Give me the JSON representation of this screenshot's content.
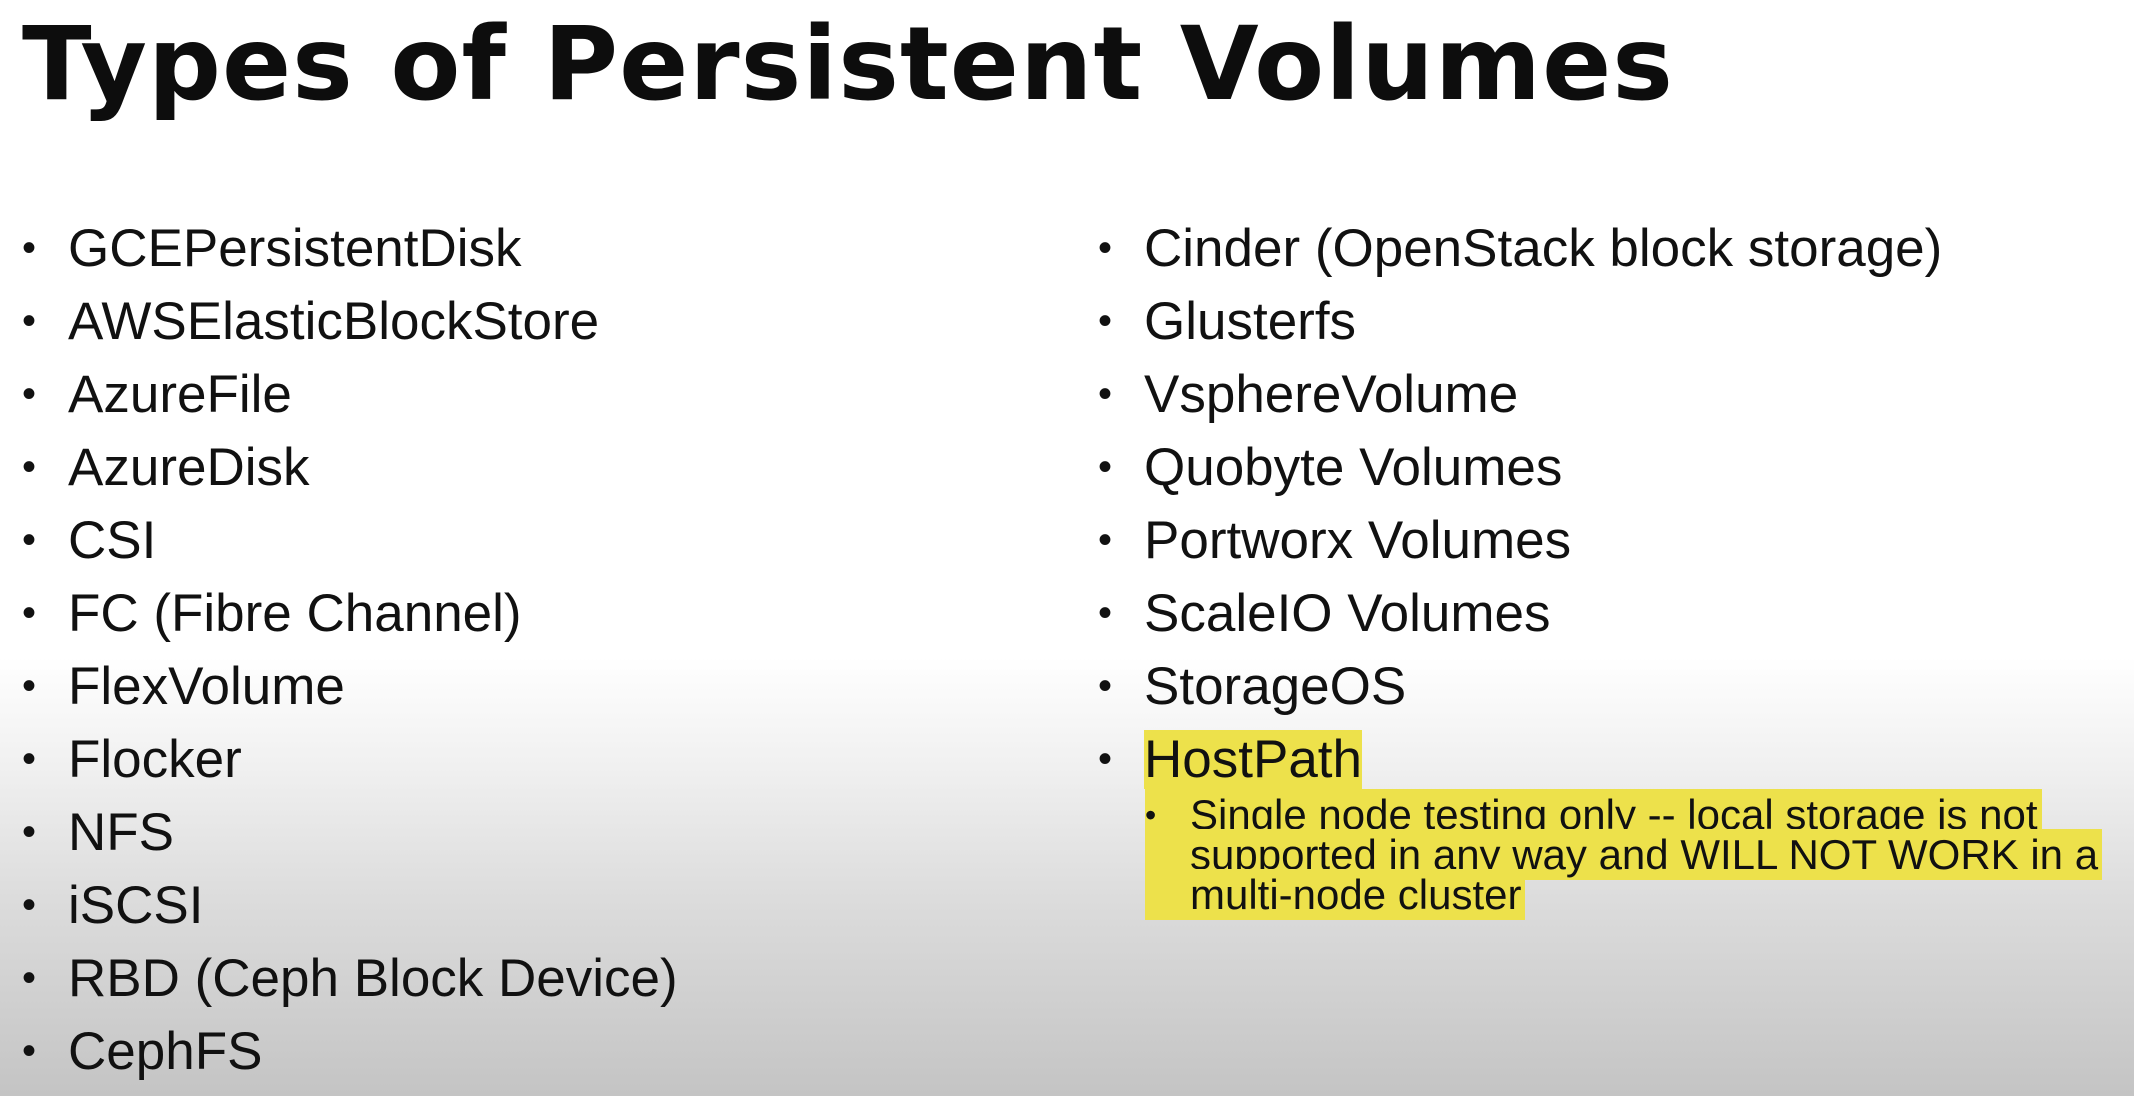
{
  "slide": {
    "title": "Types of Persistent Volumes"
  },
  "left_column": {
    "items": [
      "GCEPersistentDisk",
      "AWSElasticBlockStore",
      "AzureFile",
      "AzureDisk",
      "CSI",
      "FC (Fibre Channel)",
      "FlexVolume",
      "Flocker",
      "NFS",
      "iSCSI",
      "RBD (Ceph Block Device)",
      "CephFS"
    ]
  },
  "right_column": {
    "items": [
      "Cinder (OpenStack block storage)",
      "Glusterfs",
      "VsphereVolume",
      "Quobyte Volumes",
      "Portworx Volumes",
      "ScaleIO Volumes",
      "StorageOS",
      "HostPath"
    ],
    "highlighted_item": "HostPath",
    "sub_item": "Single node testing only -- local storage is not supported in any way and WILL NOT WORK in a multi-node cluster"
  },
  "bullet_glyph": "•",
  "colors": {
    "highlight": "#ede14b",
    "text": "#111111"
  }
}
